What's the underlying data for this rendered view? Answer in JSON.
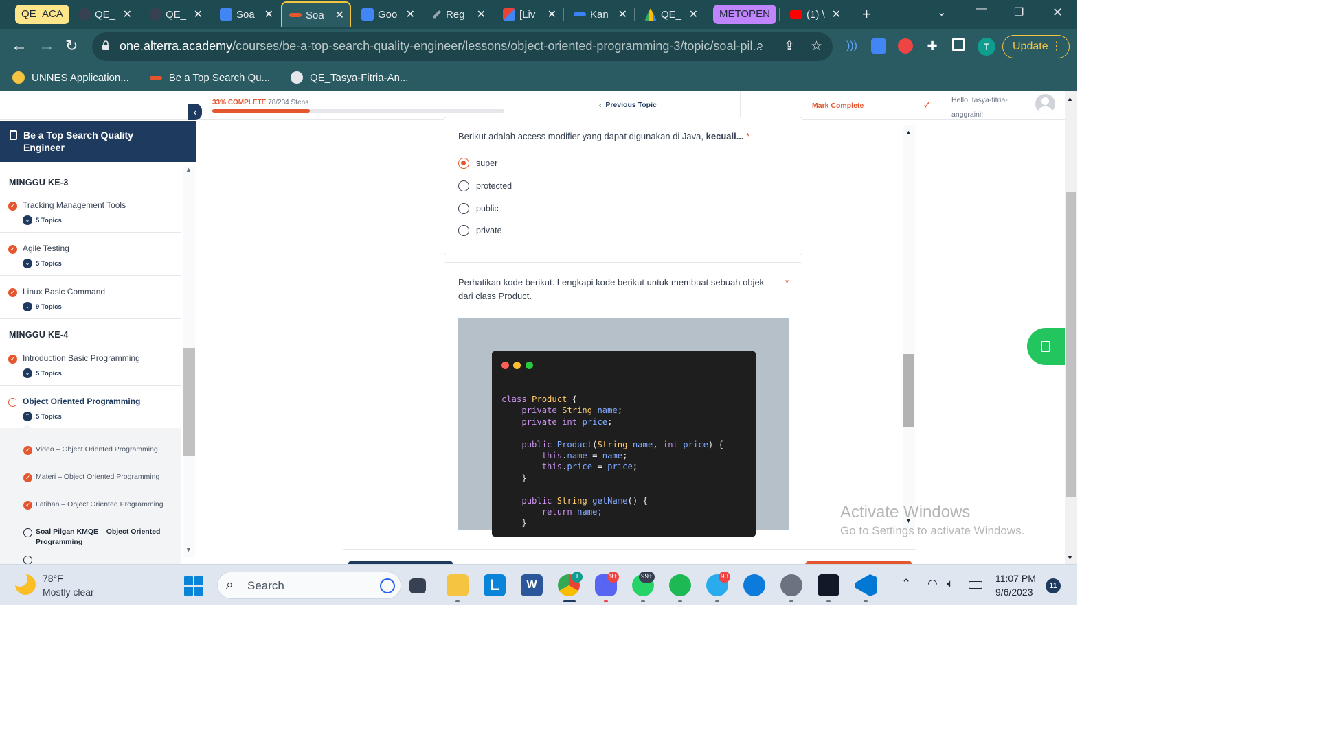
{
  "browser": {
    "tab_groups": [
      {
        "label": "QE_ACA",
        "color": "#fde68a"
      },
      {
        "label": "METOPEN",
        "color": "#c084fc"
      }
    ],
    "tabs": [
      {
        "title": "QE_",
        "icon": "github-icon",
        "color": "#e5e7eb"
      },
      {
        "title": "QE_",
        "icon": "github-icon",
        "color": "#e5e7eb"
      },
      {
        "title": "Soa",
        "icon": "google-docs-icon",
        "color": "#4285f4"
      },
      {
        "title": "Soa",
        "icon": "alterra-icon",
        "color": "#e4572e",
        "active": true
      },
      {
        "title": "Goo",
        "icon": "google-translate-icon",
        "color": "#4285f4"
      },
      {
        "title": "Reg",
        "icon": "pencil-icon",
        "color": "#9ca3af"
      },
      {
        "title": "[Liv",
        "icon": "gmail-icon",
        "color": "#ea4335"
      },
      {
        "title": "Kan",
        "icon": "flag-icon",
        "color": "#3b82f6"
      },
      {
        "title": "QE_",
        "icon": "google-drive-icon",
        "color": "#fbbc04"
      },
      {
        "title": "(1) \\",
        "icon": "youtube-icon",
        "color": "#ff0000"
      }
    ],
    "url_domain": "one.alterra.academy",
    "url_path": "/courses/be-a-top-search-quality-engineer/lessons/object-oriented-programming-3/topic/soal-pil...",
    "update_label": "Update",
    "profile_initial": "T",
    "bookmarks": [
      {
        "label": "UNNES Application...",
        "icon": "unnes-icon",
        "color": "#f5c542"
      },
      {
        "label": "Be a Top Search Qu...",
        "icon": "alterra-icon",
        "color": "#e4572e"
      },
      {
        "label": "QE_Tasya-Fitria-An...",
        "icon": "github-icon",
        "color": "#e5e7eb"
      }
    ]
  },
  "topbar": {
    "progress_pct_label": "33% COMPLETE",
    "progress_steps": "78/234 Steps",
    "progress_fraction": 0.333,
    "previous_topic": "Previous Topic",
    "mark_complete": "Mark Complete",
    "greeting": "Hello, tasya-fitria-anggraini!"
  },
  "sidebar": {
    "course_title": "Be a Top Search Quality Engineer",
    "weeks": [
      {
        "title": "MINGGU KE-3",
        "lessons": [
          {
            "name": "Tracking Management Tools",
            "topics": "5 Topics"
          },
          {
            "name": "Agile Testing",
            "topics": "5 Topics"
          },
          {
            "name": "Linux Basic Command",
            "topics": "9 Topics"
          }
        ]
      },
      {
        "title": "MINGGU KE-4",
        "lessons": [
          {
            "name": "Introduction Basic Programming",
            "topics": "5 Topics"
          },
          {
            "name": "Object Oriented Programming",
            "topics": "5 Topics"
          }
        ]
      }
    ],
    "subtopics": [
      "Video – Object Oriented Programming",
      "Materi – Object Oriented Programming",
      "Latihan – Object Oriented Programming",
      "Soal Pilgan KMQE – Object Oriented Programming"
    ]
  },
  "quiz": {
    "q1_text": "Berikut adalah access modifier yang dapat digunakan di Java, ",
    "q1_bold": "kecuali...",
    "q1_options": [
      "super",
      "protected",
      "public",
      "private"
    ],
    "q1_selected": "super",
    "q2_text": "Perhatikan kode berikut. Lengkapi kode berikut untuk membuat sebuah objek dari class Product.",
    "required_marker": "*"
  },
  "watermark": {
    "line1": "Activate Windows",
    "line2": "Go to Settings to activate Windows."
  },
  "taskbar": {
    "temperature": "78°F",
    "condition": "Mostly clear",
    "search_label": "Search",
    "apps": [
      {
        "name": "file-explorer-icon",
        "color": "#f5c542"
      },
      {
        "name": "desktop-icon",
        "color": "#374151"
      },
      {
        "name": "lexi-icon",
        "color": "#0a84d8"
      },
      {
        "name": "word-icon",
        "color": "#2b579a"
      },
      {
        "name": "chrome-icon",
        "color": "#34a853",
        "badge": "T"
      },
      {
        "name": "discord-icon",
        "color": "#5865f2",
        "badge": "9+"
      },
      {
        "name": "whatsapp-icon",
        "color": "#25d366",
        "badge": "99+"
      },
      {
        "name": "spotify-icon",
        "color": "#1db954"
      },
      {
        "name": "telegram-icon",
        "color": "#2aabee",
        "badge": "93"
      },
      {
        "name": "edge-icon",
        "color": "#0c7bdc"
      },
      {
        "name": "settings-icon",
        "color": "#6b7280"
      },
      {
        "name": "intellij-icon",
        "color": "#111827"
      },
      {
        "name": "vscode-icon",
        "color": "#0078d4"
      }
    ],
    "time": "11:07 PM",
    "date": "9/6/2023",
    "notifications": "11"
  }
}
